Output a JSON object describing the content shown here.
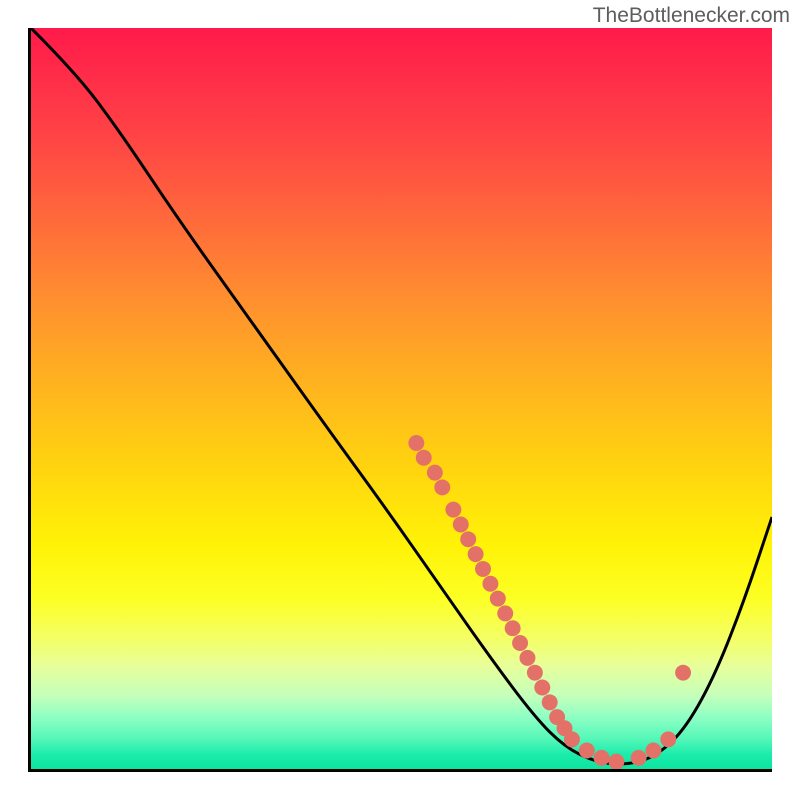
{
  "attribution": "TheBottlenecker.com",
  "chart_data": {
    "type": "line",
    "title": "",
    "xlabel": "",
    "ylabel": "",
    "xlim": [
      0,
      100
    ],
    "ylim": [
      0,
      100
    ],
    "curve_points": [
      {
        "x": 0,
        "y": 100
      },
      {
        "x": 6,
        "y": 94
      },
      {
        "x": 12,
        "y": 86
      },
      {
        "x": 20,
        "y": 74
      },
      {
        "x": 30,
        "y": 60
      },
      {
        "x": 40,
        "y": 46
      },
      {
        "x": 48,
        "y": 35
      },
      {
        "x": 55,
        "y": 25
      },
      {
        "x": 62,
        "y": 15
      },
      {
        "x": 68,
        "y": 7
      },
      {
        "x": 72,
        "y": 3
      },
      {
        "x": 76,
        "y": 1
      },
      {
        "x": 80,
        "y": 0.5
      },
      {
        "x": 84,
        "y": 1.5
      },
      {
        "x": 88,
        "y": 5
      },
      {
        "x": 92,
        "y": 12
      },
      {
        "x": 96,
        "y": 22
      },
      {
        "x": 100,
        "y": 34
      }
    ],
    "markers": [
      {
        "x": 52,
        "y": 44
      },
      {
        "x": 53,
        "y": 42
      },
      {
        "x": 54.5,
        "y": 40
      },
      {
        "x": 55.5,
        "y": 38
      },
      {
        "x": 57,
        "y": 35
      },
      {
        "x": 58,
        "y": 33
      },
      {
        "x": 59,
        "y": 31
      },
      {
        "x": 60,
        "y": 29
      },
      {
        "x": 61,
        "y": 27
      },
      {
        "x": 62,
        "y": 25
      },
      {
        "x": 63,
        "y": 23
      },
      {
        "x": 64,
        "y": 21
      },
      {
        "x": 65,
        "y": 19
      },
      {
        "x": 66,
        "y": 17
      },
      {
        "x": 67,
        "y": 15
      },
      {
        "x": 68,
        "y": 13
      },
      {
        "x": 69,
        "y": 11
      },
      {
        "x": 70,
        "y": 9
      },
      {
        "x": 71,
        "y": 7
      },
      {
        "x": 72,
        "y": 5.5
      },
      {
        "x": 73,
        "y": 4
      },
      {
        "x": 75,
        "y": 2.5
      },
      {
        "x": 77,
        "y": 1.5
      },
      {
        "x": 79,
        "y": 1
      },
      {
        "x": 82,
        "y": 1.5
      },
      {
        "x": 84,
        "y": 2.5
      },
      {
        "x": 86,
        "y": 4
      },
      {
        "x": 88,
        "y": 13
      }
    ],
    "marker_color": "#e37168",
    "curve_color": "#000000",
    "gradient": {
      "top": "#ff1a4a",
      "middle": "#fff307",
      "bottom": "#0be49f"
    }
  }
}
